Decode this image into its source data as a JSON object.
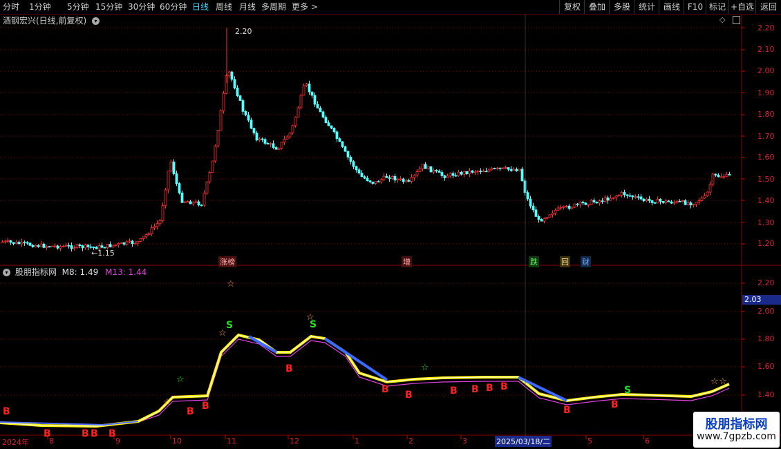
{
  "toolbar": {
    "periods": [
      "分时",
      "1分钟",
      "5分钟",
      "15分钟",
      "30分钟",
      "60分钟",
      "日线",
      "周线",
      "月线",
      "多周期",
      "更多 >"
    ],
    "active_period": "日线",
    "right_buttons": [
      "复权",
      "叠加",
      "多股",
      "统计",
      "画线",
      "F10",
      "标记",
      "+自选",
      "返回"
    ]
  },
  "main_pane": {
    "title": "酒钢宏兴(日线,前复权)",
    "high_label": "2.20",
    "low_label": "←1.15",
    "events": [
      "涨榜",
      "增",
      "跌",
      "回",
      "财"
    ],
    "y_ticks": [
      "2.20",
      "2.10",
      "2.00",
      "1.90",
      "1.80",
      "1.70",
      "1.60",
      "1.50",
      "1.40",
      "1.30",
      "1.20"
    ]
  },
  "indicator_pane": {
    "title": "股朋指标网",
    "m8_label": "M8: 1.49",
    "m13_label": "M13: 1.44",
    "current_value": "2.03",
    "y_ticks": [
      "2.20",
      "2.00",
      "1.80",
      "1.60",
      "1.40"
    ],
    "signals": [
      "B",
      "B",
      "B",
      "B",
      "B",
      "B",
      "B",
      "B",
      "B",
      "B",
      "B",
      "B",
      "B",
      "B",
      "B",
      "B",
      "S",
      "S",
      "S"
    ]
  },
  "x_axis": {
    "labels": [
      "2024年",
      "8",
      "9",
      "10",
      "11",
      "12",
      "1",
      "2",
      "3",
      "2025/03/18/二",
      "5",
      "6"
    ]
  },
  "watermark": {
    "title": "股朋指标网",
    "url": "www.7gpzb.com"
  },
  "colors": {
    "up": "#ff3030",
    "down": "#54ffff",
    "grid": "#8b0000",
    "m8": "#ffffff",
    "m13": "#e040e0",
    "active_tab": "#3fd0ff"
  }
}
